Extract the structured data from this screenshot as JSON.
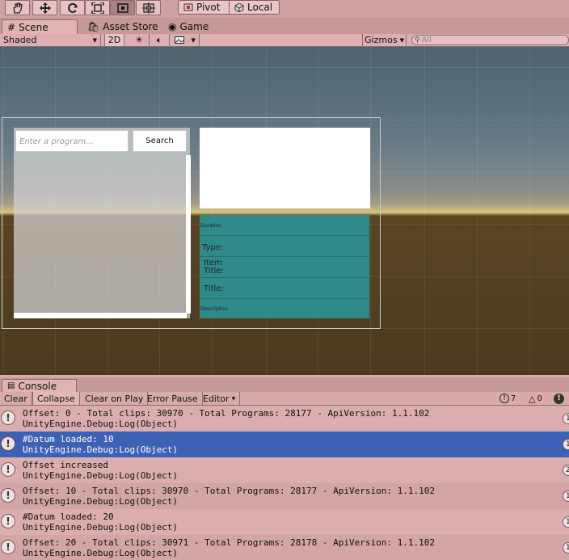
{
  "toolbar": {
    "tools": [
      "hand-tool-icon",
      "move-tool-icon",
      "rotate-tool-icon",
      "scale-tool-icon",
      "rect-tool-icon",
      "transform-tool-icon"
    ],
    "active_tool": "rect-tool-icon",
    "pivot_label": "Pivot",
    "local_label": "Local"
  },
  "tabs": {
    "scene": "Scene",
    "asset_store": "Asset Store",
    "game": "Game"
  },
  "scene_toolbar": {
    "shading_mode": "Shaded",
    "mode_2d": "2D",
    "gizmos": "Gizmos",
    "search_placeholder": "All"
  },
  "canvas": {
    "search_placeholder": "Enter a program...",
    "search_button": "Search",
    "info_rows": [
      {
        "label": "Duration"
      },
      {
        "label": "Type:"
      },
      {
        "label": "Item Title:"
      },
      {
        "label": "Title:"
      },
      {
        "label": "Description"
      }
    ]
  },
  "console": {
    "tab": "Console",
    "buttons": {
      "clear": "Clear",
      "collapse": "Collapse",
      "clear_on_play": "Clear on Play",
      "error_pause": "Error Pause",
      "editor": "Editor"
    },
    "counts": {
      "info": "7",
      "warning": "0"
    },
    "logs": [
      {
        "line1": "Offset: 0 - Total clips: 30970 - Total Programs: 28177 - ApiVersion: 1.1.102",
        "line2": "UnityEngine.Debug:Log(Object)",
        "count": "1",
        "selected": false
      },
      {
        "line1": "#Datum loaded: 10",
        "line2": "UnityEngine.Debug:Log(Object)",
        "count": "1",
        "selected": true
      },
      {
        "line1": "Offset increased",
        "line2": "UnityEngine.Debug:Log(Object)",
        "count": "2",
        "selected": false
      },
      {
        "line1": "Offset: 10 - Total clips: 30970 - Total Programs: 28177 - ApiVersion: 1.1.102",
        "line2": "UnityEngine.Debug:Log(Object)",
        "count": "1",
        "selected": false
      },
      {
        "line1": "#Datum loaded: 20",
        "line2": "UnityEngine.Debug:Log(Object)",
        "count": "1",
        "selected": false
      },
      {
        "line1": "Offset: 20 - Total clips: 30971 - Total Programs: 28178 - ApiVersion: 1.1.102",
        "line2": "UnityEngine.Debug:Log(Object)",
        "count": "1",
        "selected": false
      }
    ]
  },
  "colors": {
    "accent_selected": "#3d61b7",
    "panel_teal": "#2f8b8a"
  }
}
